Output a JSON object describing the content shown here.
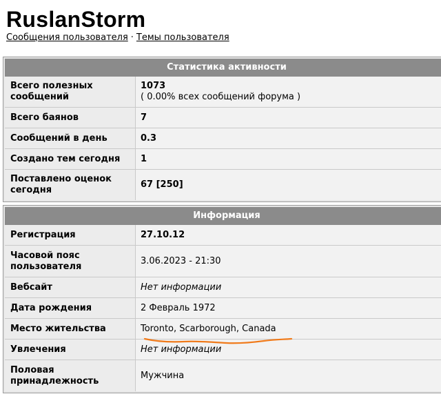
{
  "profile": {
    "username": "RuslanStorm",
    "links": {
      "messages": "Сообщения пользователя",
      "separator": "·",
      "topics": "Темы пользователя"
    }
  },
  "activity": {
    "header": "Статистика активности",
    "rows": [
      {
        "label": "Всего полезных сообщений",
        "value": "1073",
        "note": "( 0.00% всех сообщений форума )"
      },
      {
        "label": "Всего баянов",
        "value": "7"
      },
      {
        "label": "Сообщений в день",
        "value": "0.3"
      },
      {
        "label": "Создано тем сегодня",
        "value": "1"
      },
      {
        "label": "Поставлено оценок сегодня",
        "value": "67 [250]"
      }
    ]
  },
  "info": {
    "header": "Информация",
    "rows": [
      {
        "label": "Регистрация",
        "value": "27.10.12"
      },
      {
        "label": "Часовой пояс пользователя",
        "value": "3.06.2023 - 21:30"
      },
      {
        "label": "Вебсайт",
        "value": "Нет информации"
      },
      {
        "label": "Дата рождения",
        "value": "2 Февраль 1972"
      },
      {
        "label": "Место жительства",
        "value": "Toronto, Scarborough, Canada"
      },
      {
        "label": "Увлечения",
        "value": "Нет информации"
      },
      {
        "label": "Половая принадлежность",
        "value": "Мужчина"
      }
    ]
  },
  "colors": {
    "header_bg": "#8b8b8b",
    "underline_annotation": "#f07a1a"
  }
}
